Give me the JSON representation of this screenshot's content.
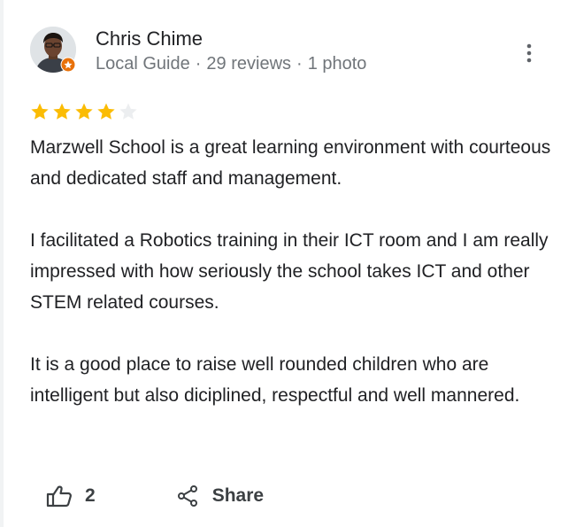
{
  "reviewer": {
    "name": "Chris Chime",
    "badge": "Local Guide",
    "review_count": "29 reviews",
    "photo_count": "1 photo",
    "separator": "·"
  },
  "review": {
    "rating": 4,
    "rating_max": 5,
    "paragraphs": [
      "Marzwell School is a great learning environment with courteous and dedicated staff and management.",
      "I facilitated a Robotics training in their ICT room and I am really impressed with how seriously the school takes ICT and other STEM related courses.",
      "It is a good place to raise well rounded children who are intelligent but also diciplined, respectful and well mannered."
    ]
  },
  "actions": {
    "like_count": "2",
    "share_label": "Share"
  },
  "colors": {
    "star_filled": "#fbbc04",
    "star_empty": "#e8eaed",
    "badge": "#e8710a",
    "text": "#202124",
    "meta": "#70757a"
  },
  "icons": {
    "more": "more-vert-icon",
    "like": "thumb-up-icon",
    "share": "share-icon",
    "badge": "local-guide-badge-icon"
  }
}
